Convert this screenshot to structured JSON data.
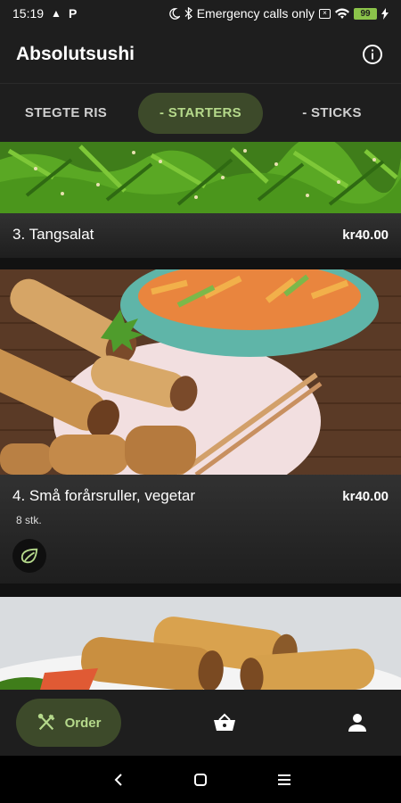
{
  "status_bar": {
    "time": "15:19",
    "warning_glyph": "▲",
    "parking_glyph": "P",
    "emergency_text": "Emergency calls only",
    "battery": "99",
    "icons": [
      "moon-icon",
      "bluetooth-icon",
      "sim-icon",
      "wifi-icon",
      "battery-icon",
      "charging-icon"
    ]
  },
  "app": {
    "title": "Absolutsushi",
    "info_icon": "info-icon",
    "accent": "#b5d98b",
    "accent_bg": "#3d4a2a"
  },
  "tabs": [
    {
      "label": "STEGTE RIS",
      "selected": false
    },
    {
      "label": "- STARTERS",
      "selected": true
    },
    {
      "label": "- STICKS",
      "selected": false
    }
  ],
  "menu_items": [
    {
      "name": "3. Tangsalat",
      "price": "kr40.00",
      "description": "",
      "vegetarian": false
    },
    {
      "name": "4. Små forårsruller, vegetar",
      "price": "kr40.00",
      "description": "8 stk.",
      "vegetarian": true
    },
    {
      "name": "",
      "price": "",
      "description": "",
      "vegetarian": false
    }
  ],
  "bottom_nav": {
    "order_label": "Order",
    "order_icon": "fork-knife-icon",
    "basket_icon": "basket-icon",
    "profile_icon": "profile-icon"
  },
  "system_nav": {
    "back_icon": "back-icon",
    "home_icon": "home-icon",
    "menu_icon": "menu-icon"
  }
}
